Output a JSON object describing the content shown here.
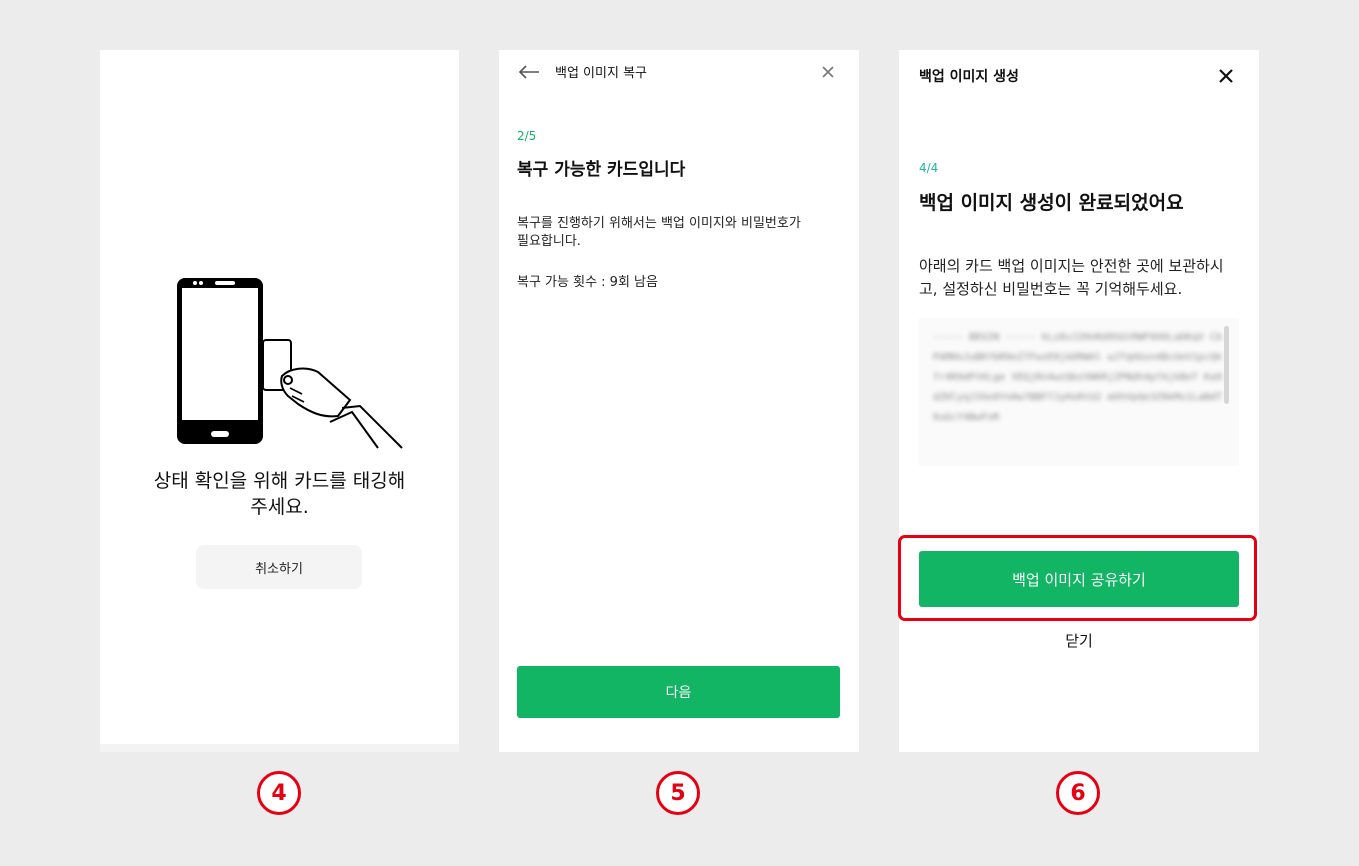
{
  "screen4": {
    "message_line1": "상태 확인을 위해 카드를 태깅해",
    "message_line2": "주세요.",
    "cancel_label": "취소하기",
    "step_badge": "4"
  },
  "screen5": {
    "header_title": "백업 이미지 복구",
    "step": "2/5",
    "heading": "복구 가능한 카드입니다",
    "desc_line1": "복구를 진행하기 위해서는 백업 이미지와 비밀번호가",
    "desc_line2": "필요합니다.",
    "attempts": "복구 가능 횟수 : 9회 남음",
    "next_label": "다음",
    "step_badge": "5"
  },
  "screen6": {
    "header_title": "백업 이미지 생성",
    "step": "4/4",
    "heading": "백업 이미지 생성이 완료되었어요",
    "desc_line1": "아래의 카드 백업 이미지는 안전한 곳에 보관하시",
    "desc_line2": "고, 설정하신 비밀번호는 꼭 기억해두세요.",
    "share_label": "백업 이미지 공유하기",
    "close_label": "닫기",
    "step_badge": "6"
  },
  "colors": {
    "accent": "#12b564",
    "highlight": "#e60012",
    "background": "#ececec"
  },
  "icons": [
    "back-arrow-icon",
    "close-icon",
    "phone-card-tag-illustration"
  ]
}
